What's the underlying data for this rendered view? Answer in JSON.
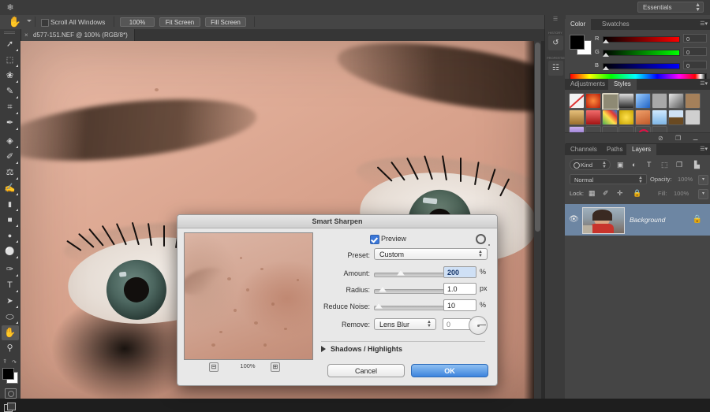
{
  "app": {
    "logo_icon": "photoshop-logo",
    "workspace": "Essentials"
  },
  "options_bar": {
    "active_tool_icon": "hand-tool-icon",
    "scroll_all_windows_label": "Scroll All Windows",
    "buttons": [
      {
        "label": "100%"
      },
      {
        "label": "Fit Screen"
      },
      {
        "label": "Fill Screen"
      }
    ]
  },
  "document": {
    "tab_title": "d577-151.NEF @ 100% (RGB/8*)",
    "close_icon": "close-icon"
  },
  "toolbar": {
    "tools": [
      {
        "name": "move-tool",
        "glyph": "➤"
      },
      {
        "name": "marquee-tool",
        "glyph": "⬚"
      },
      {
        "name": "lasso-tool",
        "glyph": "❀"
      },
      {
        "name": "quick-selection-tool",
        "glyph": "✎"
      },
      {
        "name": "crop-tool",
        "glyph": "⌗"
      },
      {
        "name": "eyedropper-tool",
        "glyph": "✒"
      },
      {
        "name": "spot-healing-brush-tool",
        "glyph": "☂"
      },
      {
        "name": "brush-tool",
        "glyph": "✐"
      },
      {
        "name": "clone-stamp-tool",
        "glyph": "⚓"
      },
      {
        "name": "history-brush-tool",
        "glyph": "✍"
      },
      {
        "name": "eraser-tool",
        "glyph": "▰"
      },
      {
        "name": "gradient-tool",
        "glyph": "■"
      },
      {
        "name": "blur-tool",
        "glyph": "●"
      },
      {
        "name": "dodge-tool",
        "glyph": "○"
      },
      {
        "name": "pen-tool",
        "glyph": "✑"
      },
      {
        "name": "type-tool",
        "glyph": "T"
      },
      {
        "name": "path-selection-tool",
        "glyph": "➤"
      },
      {
        "name": "ellipse-tool",
        "glyph": "⬭"
      },
      {
        "name": "hand-tool",
        "glyph": "✋"
      },
      {
        "name": "zoom-tool",
        "glyph": "⚲"
      }
    ],
    "selected_tool": "hand-tool",
    "foreground_color": "#000000",
    "background_color": "#ffffff",
    "quick_mask_icon": "quick-mask-icon",
    "screen_mode_icon": "screen-mode-icon"
  },
  "mini_dock": {
    "items": [
      {
        "name": "history-panel-icon",
        "glyph": "↺",
        "caption": "HISTORY"
      },
      {
        "name": "properties-panel-icon",
        "glyph": "☷",
        "caption": "PROPERTIES"
      }
    ]
  },
  "color_panel": {
    "tabs": [
      {
        "label": "Color",
        "active": true
      },
      {
        "label": "Swatches",
        "active": false
      }
    ],
    "menu_icon": "panel-menu-icon",
    "foreground_color": "#000000",
    "background_color": "#ffffff",
    "channels": [
      {
        "label": "R",
        "value": "0",
        "ramp_from": "#000000",
        "ramp_to": "#ff0000"
      },
      {
        "label": "G",
        "value": "0",
        "ramp_from": "#000000",
        "ramp_to": "#00ff00"
      },
      {
        "label": "B",
        "value": "0",
        "ramp_from": "#000000",
        "ramp_to": "#0000ff"
      }
    ]
  },
  "styles_panel": {
    "tabs": [
      {
        "label": "Adjustments",
        "active": false
      },
      {
        "label": "Styles",
        "active": true
      }
    ],
    "menu_icon": "panel-menu-icon",
    "swatches": [
      {
        "name": "none-style",
        "color": "#f2f2f2",
        "slash": true
      },
      {
        "name": "red-glow-style",
        "color": "#d63b20"
      },
      {
        "name": "bevel-style",
        "color": "#6d6a5f",
        "selected": true
      },
      {
        "name": "dark-gradient-style",
        "color": "#3d3d3d"
      },
      {
        "name": "blue-gel-style",
        "color": "#3b7fd4"
      },
      {
        "name": "gray-style",
        "color": "#a8a8a8"
      },
      {
        "name": "metal-style",
        "color": "#9a9a9a"
      },
      {
        "name": "tan-style",
        "color": "#a5805a"
      },
      {
        "name": "gold-style",
        "color": "#c8a259"
      },
      {
        "name": "crimson-style",
        "color": "#c42b2b"
      },
      {
        "name": "confetti-style",
        "color": "#6f8f4f"
      },
      {
        "name": "yellow-button-style",
        "color": "#d6c22c"
      },
      {
        "name": "orange-sunset-style",
        "color": "#cf7b3c"
      },
      {
        "name": "sky-style",
        "color": "#7fb6e6"
      },
      {
        "name": "sunset-stripe-style",
        "color": "#c8b89a"
      },
      {
        "name": "noise-style",
        "color": "#8f8f8f"
      },
      {
        "name": "purple-style",
        "color": "#8c6fc4"
      },
      {
        "name": "outline-style",
        "color": "#4a4a4a"
      },
      {
        "name": "thin-outline-style",
        "color": "#4a4a4a"
      },
      {
        "name": "square-outline-style",
        "color": "#4a4a4a"
      },
      {
        "name": "red-ring-style",
        "color": "#4a4a4a"
      },
      {
        "name": "empty-style",
        "color": "#4a4a4a"
      }
    ],
    "footer_icons": [
      {
        "name": "clear-style-icon",
        "glyph": "⊘"
      },
      {
        "name": "new-style-icon",
        "glyph": "❐"
      },
      {
        "name": "delete-style-icon",
        "glyph": "Ὕ1"
      }
    ]
  },
  "layers_panel": {
    "tabs": [
      {
        "label": "Channels",
        "active": false
      },
      {
        "label": "Paths",
        "active": false
      },
      {
        "label": "Layers",
        "active": true
      }
    ],
    "menu_icon": "panel-menu-icon",
    "filter_kind_label": "Kind",
    "filter_icons": [
      {
        "name": "filter-pixel-icon",
        "glyph": "▣"
      },
      {
        "name": "filter-adjustment-icon",
        "glyph": "◐"
      },
      {
        "name": "filter-type-icon",
        "glyph": "T"
      },
      {
        "name": "filter-shape-icon",
        "glyph": "⬚"
      },
      {
        "name": "filter-smart-object-icon",
        "glyph": "❐"
      },
      {
        "name": "filter-toggle-icon",
        "glyph": "❙"
      }
    ],
    "blend_mode": "Normal",
    "opacity_label": "Opacity:",
    "opacity_value": "100%",
    "lock_label": "Lock:",
    "lock_icons": [
      {
        "name": "lock-transparent-pixels-icon",
        "glyph": "▦"
      },
      {
        "name": "lock-image-pixels-icon",
        "glyph": "✐"
      },
      {
        "name": "lock-position-icon",
        "glyph": "✛"
      },
      {
        "name": "lock-all-icon",
        "glyph": "🔒"
      }
    ],
    "fill_label": "Fill:",
    "fill_value": "100%",
    "layers": [
      {
        "name": "Background",
        "visible_icon": "eye-visibility-icon",
        "locked_icon": "lock-icon",
        "selected": true
      }
    ]
  },
  "dialog": {
    "title": "Smart Sharpen",
    "preview_checkbox_label": "Preview",
    "preview_checked": true,
    "gear_icon": "gear-icon",
    "preview_zoom": {
      "minus_label": "⊟",
      "plus_label": "⊞",
      "value": "100%"
    },
    "preset_label": "Preset:",
    "preset_value": "Custom",
    "amount_label": "Amount:",
    "amount_value": "200",
    "amount_unit": "%",
    "amount_pct": 40,
    "radius_label": "Radius:",
    "radius_value": "1.0",
    "radius_unit": "px",
    "radius_pct": 14,
    "reduce_noise_label": "Reduce Noise:",
    "reduce_noise_value": "10",
    "reduce_noise_unit": "%",
    "reduce_noise_pct": 6,
    "remove_label": "Remove:",
    "remove_value": "Lens Blur",
    "angle_value": "0",
    "angle_unit": "°",
    "angle_dial_icon": "angle-dial-icon",
    "shadows_highlights_label": "Shadows / Highlights",
    "shadows_highlights_expanded": false,
    "cancel_label": "Cancel",
    "ok_label": "OK"
  }
}
